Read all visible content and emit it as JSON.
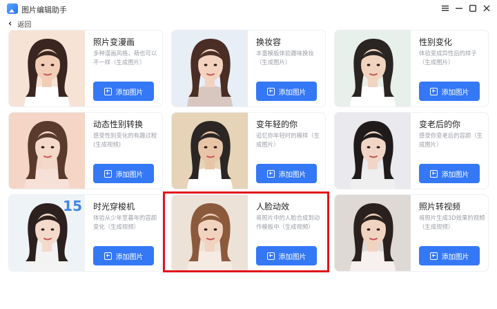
{
  "window": {
    "title": "图片编辑助手",
    "controls": [
      "minimize-menu-icon",
      "minimize-icon",
      "maximize-icon",
      "close-icon"
    ]
  },
  "nav": {
    "back_label": "返回",
    "back_icon": "chevron-left-icon"
  },
  "add_button_icon": "plus-square-icon",
  "accent_color": "#3478f6",
  "highlight_color": "#e0151b",
  "cards": [
    {
      "title": "照片变漫画",
      "desc": "多种漫画风格，萌也可以不一样（生成图片）",
      "button": "添加图片"
    },
    {
      "title": "换妆容",
      "desc": "丰富模板体验趣味换妆（生成图片）",
      "button": "添加图片"
    },
    {
      "title": "性别变化",
      "desc": "体验变成异性后的样子（生成图片）",
      "button": "添加图片"
    },
    {
      "title": "动态性别转换",
      "desc": "感受性别变化的有趣过程(生成视频)",
      "button": "添加图片"
    },
    {
      "title": "变年轻的你",
      "desc": "追忆你年轻时的模样（生成图片）",
      "button": "添加图片"
    },
    {
      "title": "变老后的你",
      "desc": "感受你变老后的容颜（生成图片）",
      "button": "添加图片"
    },
    {
      "title": "时光穿梭机",
      "desc": "体验从少年至暮年的容颜变化（生成视频）",
      "button": "添加图片"
    },
    {
      "title": "人脸动效",
      "desc": "将照片中的人脸合成到动作模板中（生成视频）",
      "button": "添加图片",
      "highlighted": true
    },
    {
      "title": "照片转视频",
      "desc": "将照片生成3D效果的视频（生成视频）",
      "button": "添加图片"
    }
  ],
  "badge_number": "15"
}
